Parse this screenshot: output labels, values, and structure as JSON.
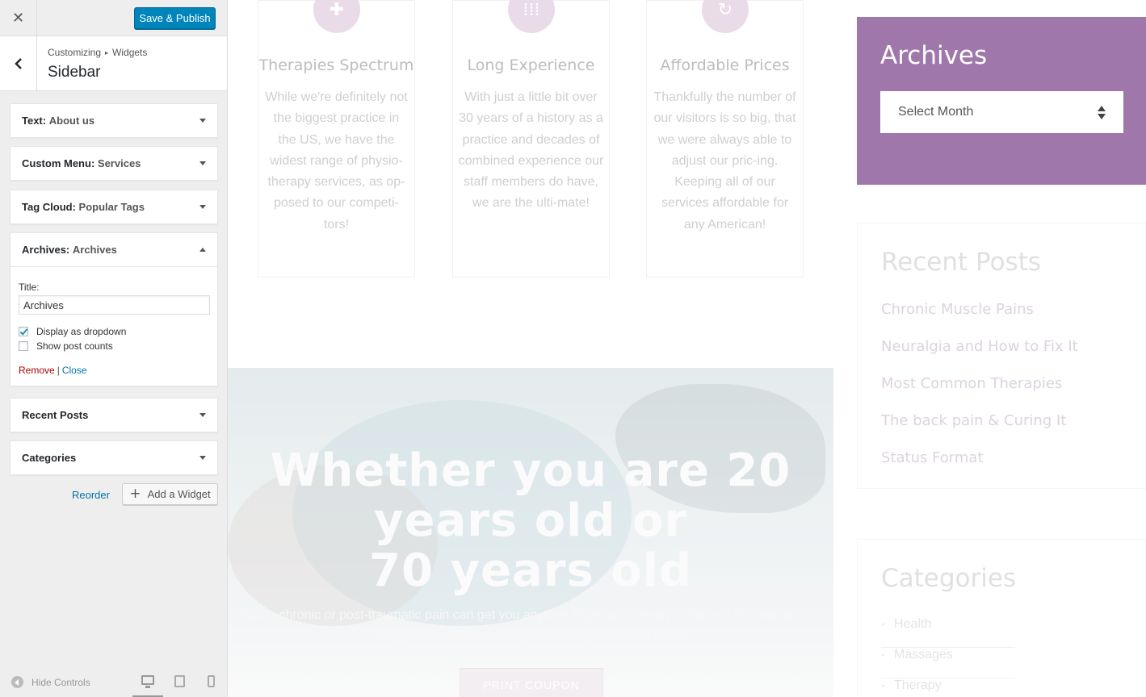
{
  "customizer": {
    "close_icon": "close-icon",
    "publish_label": "Save & Publish",
    "breadcrumb": [
      "Customizing",
      "Widgets"
    ],
    "section_title": "Sidebar",
    "widgets": [
      {
        "type": "Text:",
        "title": "About us",
        "expanded": false
      },
      {
        "type": "Custom Menu:",
        "title": "Services",
        "expanded": false
      },
      {
        "type": "Tag Cloud:",
        "title": "Popular Tags",
        "expanded": false
      },
      {
        "type": "Archives:",
        "title": "Archives",
        "expanded": true
      },
      {
        "type": "Recent Posts",
        "title": "",
        "expanded": false
      },
      {
        "type": "Categories",
        "title": "",
        "expanded": false
      }
    ],
    "archives_form": {
      "title_label": "Title:",
      "title_value": "Archives",
      "display_dropdown_label": "Display as dropdown",
      "display_dropdown_checked": true,
      "show_counts_label": "Show post counts",
      "show_counts_checked": false,
      "remove_label": "Remove",
      "separator": "|",
      "close_label": "Close"
    },
    "reorder_label": "Reorder",
    "add_widget_label": "Add a Widget",
    "hide_controls_label": "Hide Controls",
    "preview_devices": [
      "desktop",
      "tablet",
      "mobile"
    ],
    "active_device": "desktop"
  },
  "preview": {
    "features": [
      {
        "icon": "puzzle-icon",
        "title": "Therapies Spectrum",
        "text": "While we're definitely not the biggest practice in the US, we have the widest range of physio-therapy services, as op-posed to our competi-tors!"
      },
      {
        "icon": "dots-grid-icon",
        "title": "Long Experience",
        "text": "With just a little bit over 30 years of a history as a practice and decades of combined experience our staff members do have, we are the ulti-mate!"
      },
      {
        "icon": "refresh-icon",
        "title": "Affordable Prices",
        "text": "Thankfully the number of our visitors is so big, that we were always able to adjust our pric-ing. Keeping all of our services affordable for any American!"
      }
    ],
    "hero": {
      "title_line1": "Whether you are 20",
      "title_line2": "years old or",
      "title_line3": "70 years old",
      "subtitle": "Acute, chronic or post-traumatic pain can get you anytime Physical Therapy is the tool for making your body and whole health improve and get back on track!",
      "button_label": "PRINT COUPON"
    },
    "sidebar": {
      "archives_title": "Archives",
      "archives_select": "Select Month",
      "recent_title": "Recent Posts",
      "recent_posts": [
        "Chronic Muscle Pains",
        "Neuralgia and How to Fix It",
        "Most Common Therapies",
        "The back pain & Curing It",
        "Status Format"
      ],
      "categories_title": "Categories",
      "categories": [
        "Health",
        "Massages",
        "Therapy"
      ]
    },
    "colors": {
      "archives_bg": "#a077ab",
      "publish_button": "#0085ba",
      "link_blue": "#0073aa",
      "remove_red": "#a00"
    }
  }
}
